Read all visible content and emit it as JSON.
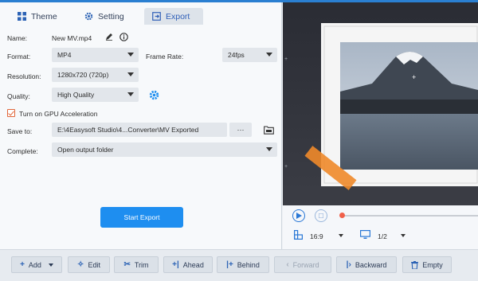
{
  "tabs": [
    {
      "label": "Theme",
      "icon": "grid-icon"
    },
    {
      "label": "Setting",
      "icon": "gear-icon"
    },
    {
      "label": "Export",
      "icon": "export-icon"
    }
  ],
  "form": {
    "name_label": "Name:",
    "name_value": "New MV.mp4",
    "format_label": "Format:",
    "format_value": "MP4",
    "framerate_label": "Frame Rate:",
    "framerate_value": "24fps",
    "resolution_label": "Resolution:",
    "resolution_value": "1280x720 (720p)",
    "quality_label": "Quality:",
    "quality_value": "High Quality",
    "gpu_label": "Turn on GPU Acceleration",
    "gpu_checked": true,
    "saveto_label": "Save to:",
    "saveto_value": "E:\\4Easysoft Studio\\4...Converter\\MV Exported",
    "browse_label": "···",
    "complete_label": "Complete:",
    "complete_value": "Open output folder"
  },
  "start_export_label": "Start Export",
  "preview": {
    "aspect": "16:9",
    "page": "1/2"
  },
  "toolbar": [
    {
      "label": "Add",
      "icon": "+",
      "name": "add-button",
      "disabled": false,
      "dropdown": true
    },
    {
      "label": "Edit",
      "icon": "✧",
      "name": "edit-button",
      "disabled": false
    },
    {
      "label": "Trim",
      "icon": "✂",
      "name": "trim-button",
      "disabled": false
    },
    {
      "label": "Ahead",
      "icon": "+|",
      "name": "ahead-button",
      "disabled": false
    },
    {
      "label": "Behind",
      "icon": "|+",
      "name": "behind-button",
      "disabled": false
    },
    {
      "label": "Forward",
      "icon": "‹",
      "name": "forward-button",
      "disabled": true
    },
    {
      "label": "Backward",
      "icon": "|›",
      "name": "backward-button",
      "disabled": false
    },
    {
      "label": "Empty",
      "icon": "🗑",
      "name": "empty-button",
      "disabled": false
    }
  ],
  "colors": {
    "accent": "#1e8ef0",
    "checkbox": "#e0663a",
    "progress_dot": "#f0604a"
  }
}
